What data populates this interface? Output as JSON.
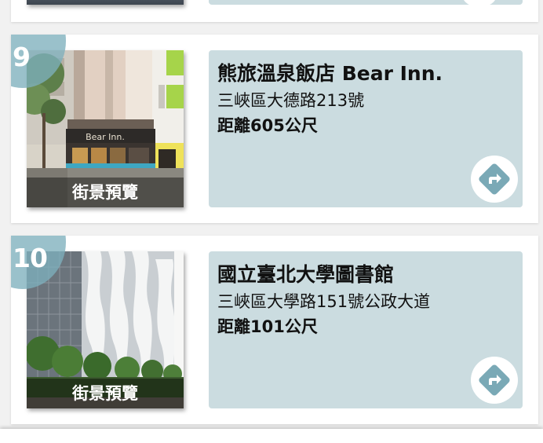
{
  "colors": {
    "card_background": "#ffffff",
    "info_panel": "#cbdce0",
    "badge": "#7eb0bd",
    "nav_icon": "#7aa9b6"
  },
  "results": [
    {
      "number": "9",
      "name": "熊旅溫泉飯店 Bear Inn.",
      "address": "三峽區大德路213號",
      "distance": "距離605公尺",
      "street_view_label": "街景預覽",
      "storefront_sign": "Bear Inn.",
      "icon": "directions-icon"
    },
    {
      "number": "10",
      "name": "國立臺北大學圖書館",
      "address": "三峽區大學路151號公政大道",
      "distance": "距離101公尺",
      "street_view_label": "街景預覽",
      "icon": "directions-icon"
    }
  ]
}
